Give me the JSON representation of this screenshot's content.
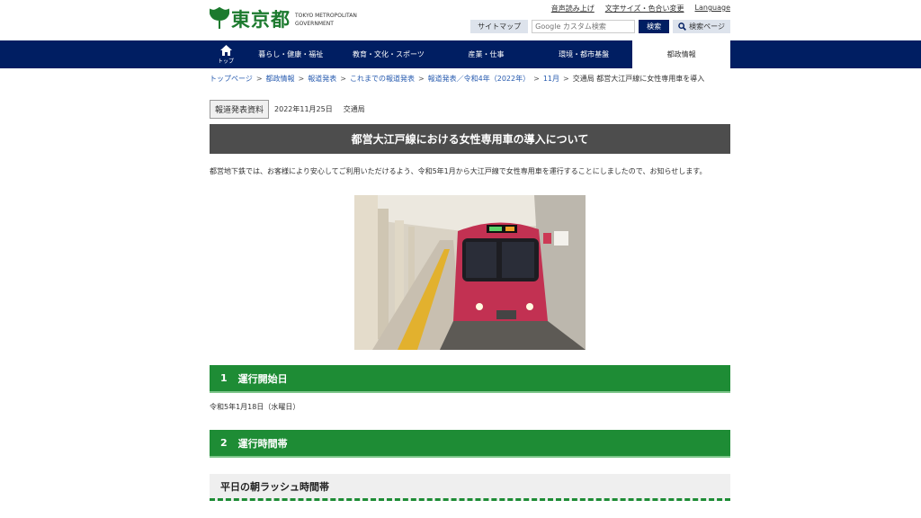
{
  "header": {
    "logo_text": "東京都",
    "logo_en_line1": "TOKYO METROPOLITAN",
    "logo_en_line2": "GOVERNMENT",
    "top_links": [
      "音声読み上げ",
      "文字サイズ・色合い変更",
      "Language"
    ],
    "sitemap_label": "サイトマップ",
    "search_placeholder": "Google カスタム検索",
    "search_button": "検索",
    "search_page_button": "検索ページ"
  },
  "nav": {
    "top_label": "トップ",
    "items": [
      "暮らし・健康・福祉",
      "教育・文化・スポーツ",
      "産業・仕事",
      "環境・都市基盤",
      "都政情報"
    ]
  },
  "breadcrumb": {
    "links": [
      "トップページ",
      "都政情報",
      "報道発表",
      "これまでの報道発表",
      "報道発表／令和4年（2022年）",
      "11月"
    ],
    "current": "交通局 都営大江戸線に女性専用車を導入",
    "separator": ">"
  },
  "article": {
    "tag": "報道発表資料",
    "date": "2022年11月25日",
    "bureau": "交通局",
    "title": "都営大江戸線における女性専用車の導入について",
    "intro": "都営地下鉄では、お客様により安心してご利用いただけるよう、令和5年1月から大江戸線で女性専用車を運行することにしましたので、お知らせします。",
    "sections": [
      {
        "num": "1",
        "title": "運行開始日",
        "text": "令和5年1月18日（水曜日）"
      },
      {
        "num": "2",
        "title": "運行時間帯"
      }
    ],
    "sub_heading": "平日の朝ラッシュ時間帯"
  },
  "colors": {
    "nav_bg": "#001e62",
    "logo_green": "#1c7a2e",
    "section_green": "#1e8c35",
    "title_bar": "#4d4d4d"
  }
}
